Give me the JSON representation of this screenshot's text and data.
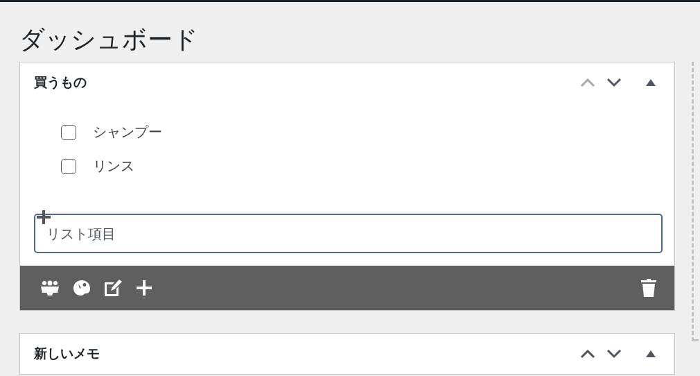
{
  "page": {
    "title": "ダッシュボード"
  },
  "panels": [
    {
      "title": "買うもの",
      "move_up": {
        "disabled": true
      },
      "move_down": {
        "disabled": false
      },
      "expanded": true,
      "items": [
        {
          "label": "シャンプー",
          "checked": false
        },
        {
          "label": "リンス",
          "checked": false
        }
      ],
      "new_item": {
        "placeholder": "リスト項目"
      },
      "toolbar": true
    },
    {
      "title": "新しいメモ",
      "move_up": {
        "disabled": false
      },
      "move_down": {
        "disabled": false
      },
      "expanded": true
    }
  ]
}
